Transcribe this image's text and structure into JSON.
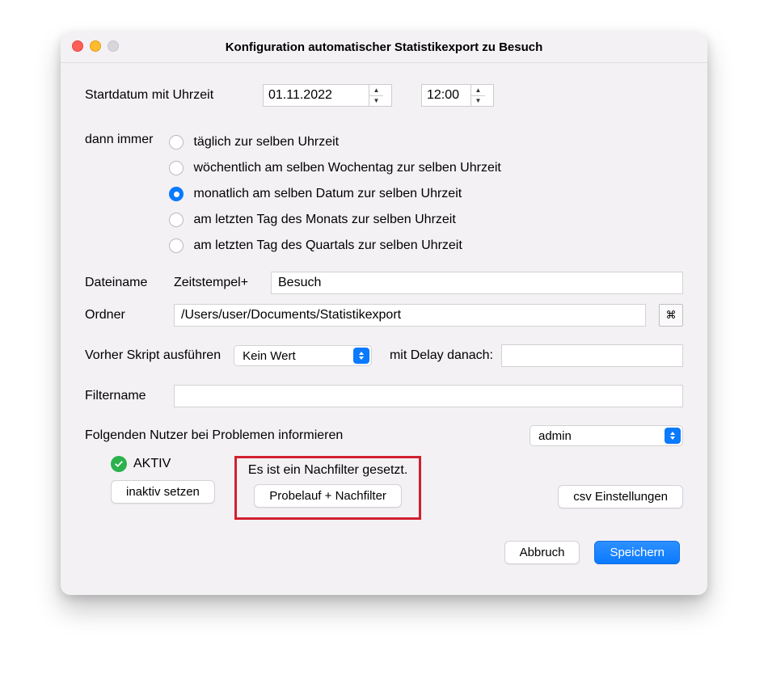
{
  "window": {
    "title": "Konfiguration automatischer Statistikexport zu Besuch"
  },
  "start": {
    "label": "Startdatum mit Uhrzeit",
    "date": "01.11.2022",
    "time": "12:00"
  },
  "recurrence": {
    "label": "dann immer",
    "options": [
      "täglich zur selben Uhrzeit",
      "wöchentlich am selben Wochentag zur selben Uhrzeit",
      "monatlich am selben Datum zur selben Uhrzeit",
      "am letzten Tag des Monats zur selben Uhrzeit",
      "am letzten Tag des Quartals zur selben Uhrzeit"
    ],
    "selected_index": 2
  },
  "filename": {
    "label": "Dateiname",
    "prefix_label": "Zeitstempel+",
    "value": "Besuch"
  },
  "folder": {
    "label": "Ordner",
    "path": "/Users/user/Documents/Statistikexport"
  },
  "script": {
    "label": "Vorher Skript ausführen",
    "value": "Kein Wert",
    "delay_label": "mit Delay danach:",
    "delay_value": ""
  },
  "filter": {
    "label": "Filtername",
    "value": ""
  },
  "notify": {
    "label": "Folgenden Nutzer bei Problemen informieren",
    "user": "admin"
  },
  "status": {
    "active_label": "AKTIV",
    "inactive_button": "inaktiv setzen"
  },
  "postfilter": {
    "message": "Es ist ein Nachfilter gesetzt.",
    "button": "Probelauf + Nachfilter"
  },
  "csv": {
    "button": "csv Einstellungen"
  },
  "footer": {
    "cancel": "Abbruch",
    "save": "Speichern"
  }
}
